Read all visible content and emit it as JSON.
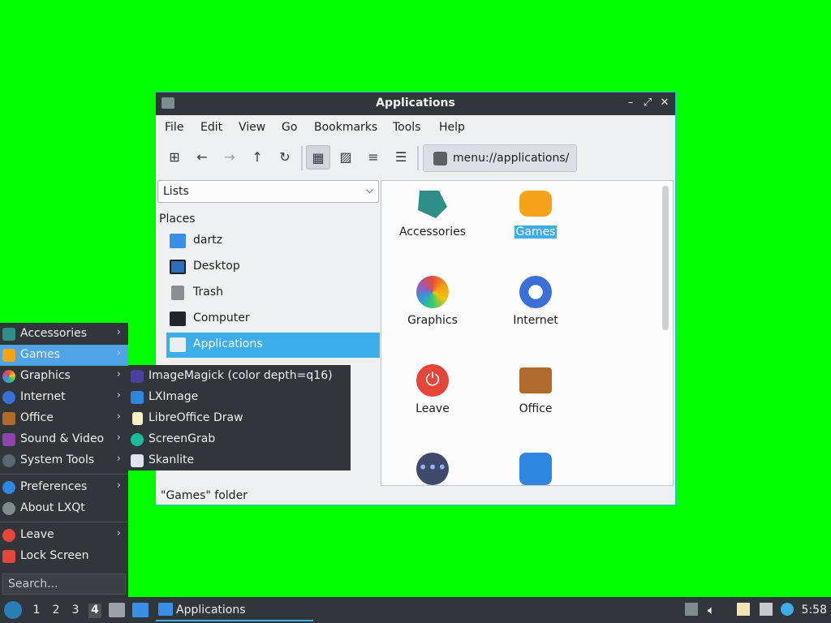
{
  "window": {
    "title": "Applications",
    "controls": {
      "minimize": "–",
      "restore": "⤢",
      "close": "✕"
    }
  },
  "menubar": [
    "File",
    "Edit",
    "View",
    "Go",
    "Bookmarks",
    "Tools",
    "Help"
  ],
  "toolbar": {
    "icons": [
      "new-tab-icon",
      "back-icon",
      "forward-icon",
      "up-icon",
      "reload-icon",
      "icon-view-icon",
      "thumbnail-view-icon",
      "compact-view-icon",
      "detailed-view-icon"
    ],
    "path": "menu://applications/"
  },
  "sidepane": {
    "mode": "Lists",
    "places_header": "Places",
    "places": [
      {
        "label": "dartz",
        "icon": "home-folder-icon"
      },
      {
        "label": "Desktop",
        "icon": "desktop-icon"
      },
      {
        "label": "Trash",
        "icon": "trash-icon"
      },
      {
        "label": "Computer",
        "icon": "computer-icon"
      },
      {
        "label": "Applications",
        "icon": "applications-icon",
        "selected": true
      }
    ]
  },
  "iconview": {
    "items": [
      {
        "label": "Accessories",
        "icon": "accessories-icon"
      },
      {
        "label": "Games",
        "icon": "games-icon",
        "selected": true
      },
      {
        "label": "Graphics",
        "icon": "graphics-icon"
      },
      {
        "label": "Internet",
        "icon": "internet-icon"
      },
      {
        "label": "Leave",
        "icon": "leave-icon"
      },
      {
        "label": "Office",
        "icon": "office-icon"
      },
      {
        "label": "",
        "icon": "more-icon"
      },
      {
        "label": "",
        "icon": "preferences-icon"
      }
    ]
  },
  "statusbar": "\"Games\" folder",
  "startmenu": {
    "items": [
      {
        "label": "Accessories",
        "arrow": true
      },
      {
        "label": "Games",
        "arrow": true,
        "highlighted": true
      },
      {
        "label": "Graphics",
        "arrow": true
      },
      {
        "label": "Internet",
        "arrow": true
      },
      {
        "label": "Office",
        "arrow": true
      },
      {
        "label": "Sound & Video",
        "arrow": true
      },
      {
        "label": "System Tools",
        "arrow": true
      },
      {
        "label": "Preferences",
        "arrow": true
      },
      {
        "label": "About LXQt",
        "arrow": false
      },
      {
        "label": "Leave",
        "arrow": true
      },
      {
        "label": "Lock Screen",
        "arrow": false
      }
    ],
    "search_placeholder": "Search..."
  },
  "submenu": {
    "items": [
      "ImageMagick (color depth=q16)",
      "LXImage",
      "LibreOffice Draw",
      "ScreenGrab",
      "Skanlite"
    ]
  },
  "taskbar": {
    "desktops": [
      "1",
      "2",
      "3",
      "4"
    ],
    "current_desktop": "4",
    "task_label": "Applications",
    "clock": "5:58"
  }
}
